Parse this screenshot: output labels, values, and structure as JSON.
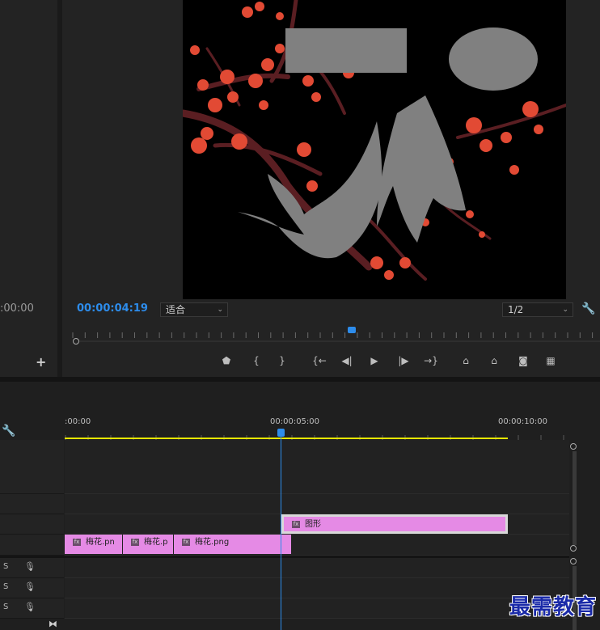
{
  "source_monitor": {
    "timecode": ":00:00",
    "add_label": "+"
  },
  "program_monitor": {
    "timecode": "00:00:04:19",
    "zoom": "适合",
    "resolution": "1/2",
    "playhead_fraction": 0.53,
    "controls": [
      {
        "name": "add-marker-icon",
        "glyph": "⬟"
      },
      {
        "name": "mark-in-icon",
        "glyph": "{"
      },
      {
        "name": "mark-out-icon",
        "glyph": "}"
      },
      {
        "name": "go-to-in-icon",
        "glyph": "{←"
      },
      {
        "name": "step-back-icon",
        "glyph": "◀|"
      },
      {
        "name": "play-icon",
        "glyph": "▶"
      },
      {
        "name": "step-forward-icon",
        "glyph": "|▶"
      },
      {
        "name": "go-to-out-icon",
        "glyph": "→}"
      },
      {
        "name": "lift-icon",
        "glyph": "⌂"
      },
      {
        "name": "extract-icon",
        "glyph": "⌂"
      },
      {
        "name": "export-frame-icon",
        "glyph": "◙"
      },
      {
        "name": "comparison-view-icon",
        "glyph": "▦"
      }
    ]
  },
  "timeline": {
    "ruler_labels": [
      ":00:00",
      "00:00:05:00",
      "00:00:10:00"
    ],
    "clips": {
      "v3": {
        "label": "图形"
      },
      "v2": [
        {
          "label": "梅花.pn"
        },
        {
          "label": "梅花.p"
        },
        {
          "label": "梅花.png"
        }
      ]
    },
    "audio_tracks": [
      {
        "solo": "S"
      },
      {
        "solo": "S"
      },
      {
        "solo": "S"
      }
    ]
  },
  "watermark": "最需教育",
  "colors": {
    "accent_blue": "#2d8ceb",
    "clip_pink": "#e58ae5",
    "work_area_yellow": "#e6e600",
    "panel_bg": "#232323"
  }
}
